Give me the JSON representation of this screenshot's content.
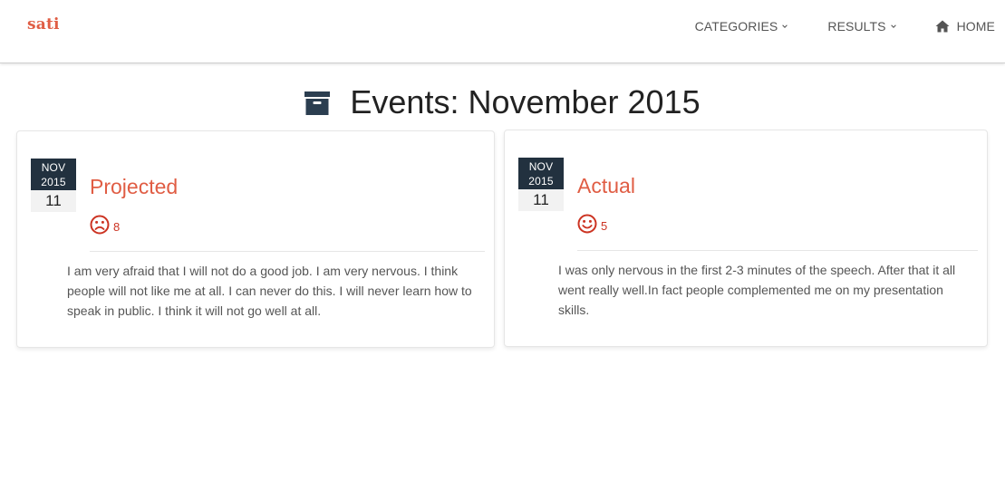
{
  "navbar": {
    "brand": "sati",
    "items": [
      {
        "label": "CATEGORIES",
        "icon": "chevron-down-icon"
      },
      {
        "label": "RESULTS",
        "icon": "chevron-down-icon"
      },
      {
        "label": "HOME",
        "icon": "home-icon"
      }
    ]
  },
  "page": {
    "title": "Events: November 2015",
    "title_icon": "archive-icon"
  },
  "events": [
    {
      "month": "NOV",
      "year": "2015",
      "day": "11",
      "title": "Projected",
      "mood_icon": "sad-face-icon",
      "score": "8",
      "description": "I am very afraid that I will not do a good job. I am very nervous. I think people will not like me at all. I can never do this. I will never learn how to speak in public. I think it will not go well at all."
    },
    {
      "month": "NOV",
      "year": "2015",
      "day": "11",
      "title": "Actual",
      "mood_icon": "smile-face-icon",
      "score": "5",
      "description": "I was only nervous in the first 2-3 minutes of the speech. After that it all went really well.In fact people complemented me on my presentation skills."
    }
  ],
  "colors": {
    "brand": "#e05d44",
    "badge": "#22313f",
    "mood": "#cc3322"
  }
}
